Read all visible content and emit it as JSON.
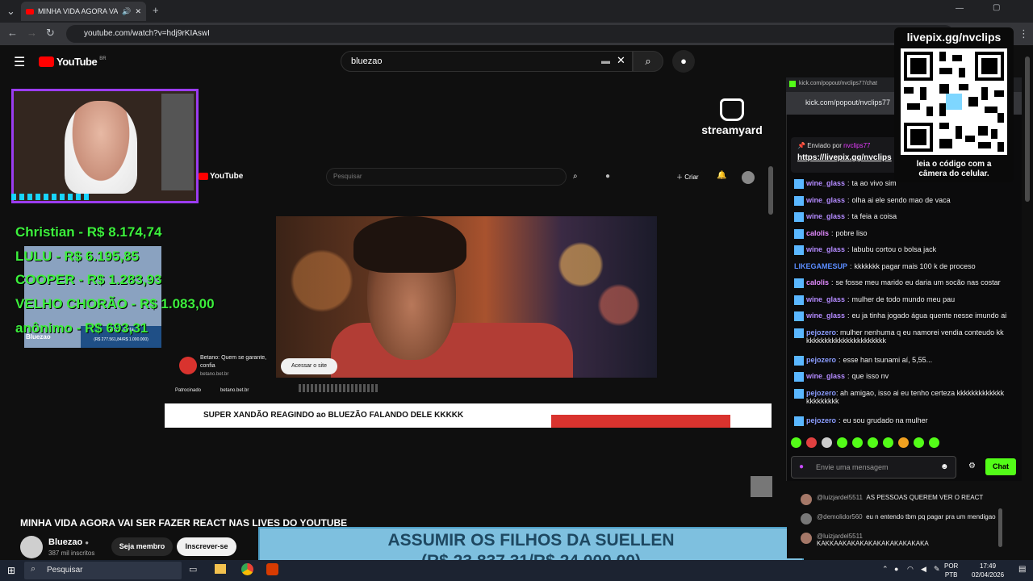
{
  "browser": {
    "tab_title": "MINHA VIDA AGORA VAI SE",
    "url": "youtube.com/watch?v=hdj9rKIAswI",
    "popout_title": "kick.com/popout/nvclips77/chat",
    "popout_url": "kick.com/popout/nvclips77"
  },
  "youtube": {
    "logo": "YouTube",
    "logo_region": "BR",
    "search_value": "bluezao",
    "video_title": "MINHA VIDA AGORA VAI SER FAZER REACT NAS LIVES DO YOUTUBE",
    "channel_name": "Bluezao",
    "subscribers": "387 mil inscritos",
    "join_label": "Seja membro",
    "subscribe_label": "Inscrever-se"
  },
  "inner_video": {
    "logo": "YouTube",
    "search_placeholder": "Pesquisar",
    "create_label": "Criar",
    "ad_brand": "Betano: Quem se garante, confia",
    "ad_domain": "betano.bet.br",
    "ad_cta": "Acessar o site",
    "sponsored": "Patrocinado",
    "sponsored_domain": "betano.bet.br",
    "title": "SUPER XANDÃO REAGINDO ao BLUEZÃO FALANDO DELE KKKKK"
  },
  "overlay": {
    "donors": [
      "Christian - R$ 8.174,74",
      "LULU - R$ 6.195,85",
      "COOPER - R$ 1.283,93",
      "VELHO CHORÃO - R$ 1.083,00",
      "anônimo - R$ 693,31"
    ],
    "meta_name": "Bluezao",
    "meta_label": "Minha meta",
    "meta_values": "(R$ 277.561,84/R$ 1.000.000)",
    "streamyard": "streamyard",
    "goal_line1": "ASSUMIR OS FILHOS DA SUELLEN",
    "goal_line2": "(R$ 23.837,31/R$ 24.000,00)"
  },
  "qr": {
    "title": "livepix.gg/nvclips",
    "caption_line1": "leia o código com a",
    "caption_line2": "câmera do celular."
  },
  "kick_chat": {
    "pinned_by": "Enviado por",
    "pinned_user": "nvclips77",
    "pinned_link": "https://livepix.gg/nvclips",
    "messages": [
      {
        "user": "wine_glass",
        "text": "ta ao vivo sim",
        "color": "#b48bff"
      },
      {
        "user": "wine_glass",
        "text": "olha ai ele sendo mao de vaca",
        "color": "#b48bff"
      },
      {
        "user": "wine_glass",
        "text": "ta feia a coisa",
        "color": "#b48bff"
      },
      {
        "user": "calolis",
        "text": "pobre liso",
        "color": "#e38bff"
      },
      {
        "user": "wine_glass",
        "text": "labubu cortou o bolsa jack",
        "color": "#b48bff"
      },
      {
        "user": "LIKEGAMESUP",
        "text": "kkkkkkk pagar mais 100 k de proceso",
        "color": "#5a8cff"
      },
      {
        "user": "calolis",
        "text": "se fosse meu marido eu daria um socão nas costar",
        "color": "#e38bff"
      },
      {
        "user": "wine_glass",
        "text": "mulher de todo mundo meu pau",
        "color": "#b48bff"
      },
      {
        "user": "wine_glass",
        "text": "eu ja tinha jogado água quente nesse imundo ai",
        "color": "#b48bff"
      },
      {
        "user": "pejozero",
        "text": "mulher nenhuma q eu namorei vendia conteudo kkkkkkkkkkkkkkkkkkkkkkkk",
        "color": "#8b9dff"
      },
      {
        "user": "pejozero",
        "text": "esse han tsunami aí, 5,55...",
        "color": "#8b9dff"
      },
      {
        "user": "wine_glass",
        "text": "que isso nv",
        "color": "#b48bff"
      },
      {
        "user": "pejozero",
        "text": "ah amigao, isso ai eu tenho certeza kkkkkkkkkkkkkkkkkkkkkk",
        "color": "#8b9dff"
      },
      {
        "user": "pejozero",
        "text": "eu sou grudado na mulher",
        "color": "#8b9dff"
      }
    ],
    "input_placeholder": "Envie uma mensagem",
    "chat_button": "Chat"
  },
  "yt_chat": [
    {
      "user": "@luizjardel5511",
      "text": "AS PESSOAS QUEREM VER O REACT"
    },
    {
      "user": "@demolidor560",
      "text": "eu n entendo tbm pq pagar pra um mendigao"
    },
    {
      "user": "@luizjardel5511",
      "text": "KAKKAAKAKAKAKAKAKAKAKAKAKA"
    }
  ],
  "taskbar": {
    "search_placeholder": "Pesquisar",
    "lang1": "POR",
    "lang2": "PTB",
    "time": "17:49",
    "date": "02/04/2026"
  }
}
